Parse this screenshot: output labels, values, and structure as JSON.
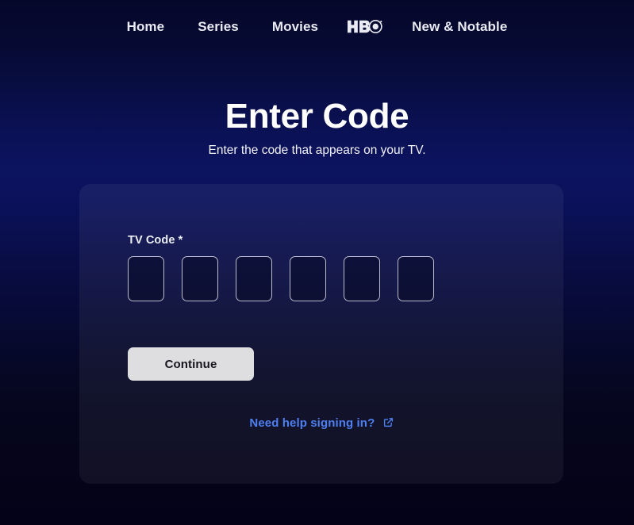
{
  "nav": {
    "items": [
      {
        "label": "Home",
        "name": "nav-item-home",
        "type": "text"
      },
      {
        "label": "Series",
        "name": "nav-item-series",
        "type": "text"
      },
      {
        "label": "Movies",
        "name": "nav-item-movies",
        "type": "text"
      },
      {
        "label": "HBO",
        "name": "nav-item-hbo",
        "type": "logo"
      },
      {
        "label": "New & Notable",
        "name": "nav-item-new-and-notable",
        "type": "text"
      }
    ]
  },
  "header": {
    "title": "Enter Code",
    "subtitle": "Enter the code that appears on your TV."
  },
  "form": {
    "label": "TV Code",
    "required_marker": "*",
    "code_digits": [
      "",
      "",
      "",
      "",
      "",
      ""
    ],
    "code_length": 6,
    "submit_label": "Continue",
    "help_label": "Need help signing in?",
    "help_icon": "external-link-icon"
  },
  "colors": {
    "accent_link": "#4d7fef",
    "button_background": "#dedee1",
    "button_text": "#15151c",
    "page_top": "#05072a",
    "page_mid": "#0c1360",
    "page_bottom": "#050318",
    "input_border": "#b9bcce"
  }
}
